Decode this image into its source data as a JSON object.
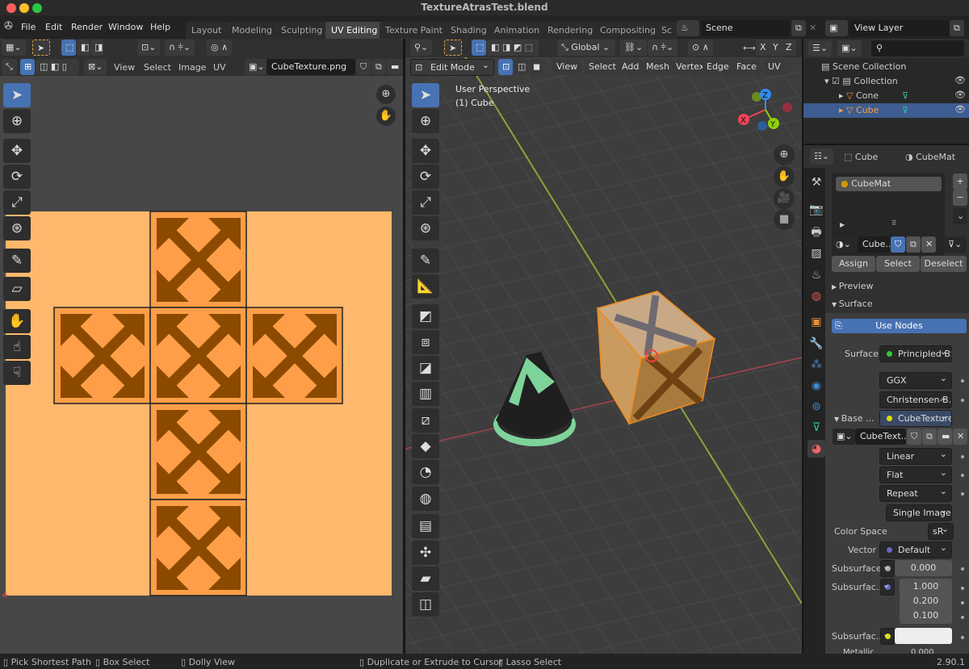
{
  "window": {
    "title": "TextureAtrasTest.blend"
  },
  "menu": [
    "File",
    "Edit",
    "Render",
    "Window",
    "Help"
  ],
  "workspaces": [
    {
      "label": "Layout"
    },
    {
      "label": "Modeling"
    },
    {
      "label": "Sculpting"
    },
    {
      "label": "UV Editing",
      "active": true
    },
    {
      "label": "Texture Paint"
    },
    {
      "label": "Shading"
    },
    {
      "label": "Animation"
    },
    {
      "label": "Rendering"
    },
    {
      "label": "Compositing"
    },
    {
      "label": "Sc"
    }
  ],
  "scene": {
    "name": "Scene",
    "view_layer": "View Layer"
  },
  "uv_editor": {
    "menus": [
      "View",
      "Select",
      "Image",
      "UV"
    ],
    "image_name": "CubeTexture.png",
    "colors": {
      "image_bg": "#ffb86c",
      "face": "#ff9e48",
      "arrow": "#8b4a00"
    }
  },
  "viewport": {
    "mode": "Edit Mode",
    "orientation": "Global",
    "menus": [
      "View",
      "Select",
      "Add",
      "Mesh",
      "Vertex",
      "Edge",
      "Face",
      "UV"
    ],
    "axes": [
      "X",
      "Y",
      "Z"
    ],
    "overlay_line1": "User Perspective",
    "overlay_line2": "(1) Cube",
    "gizmo": {
      "x": "X",
      "y": "Y",
      "z": "Z"
    }
  },
  "outliner": {
    "root": "Scene Collection",
    "collection": "Collection",
    "objects": [
      {
        "name": "Cone",
        "selected": false
      },
      {
        "name": "Cube",
        "selected": true
      }
    ]
  },
  "properties": {
    "object": "Cube",
    "material": "CubeMat",
    "slots": [
      "CubeMat"
    ],
    "material_field": "Cube...",
    "buttons": {
      "assign": "Assign",
      "select": "Select",
      "deselect": "Deselect"
    },
    "panels": {
      "preview": "Preview",
      "surface": "Surface"
    },
    "use_nodes": "Use Nodes",
    "surface_label": "Surface",
    "surface_value": "Principled BS...",
    "distribution": "GGX",
    "subsurface_method": "Christensen-B...",
    "base_label": "Base ...",
    "base_value": "CubeTexture...",
    "image_field": "CubeText...",
    "interpolation": "Linear",
    "projection": "Flat",
    "extension": "Repeat",
    "source": "Single Image",
    "color_space_label": "Color Space",
    "color_space": "sR",
    "vector_label": "Vector",
    "vector_value": "Default",
    "subsurface_label": "Subsurface",
    "subsurface_value": "0.000",
    "subsurface_radius_label": "Subsurfac...",
    "subsurface_radius": [
      "1.000",
      "0.200",
      "0.100"
    ],
    "subsurface_color_label": "Subsurfac...",
    "metallic_label": "Metallic",
    "metallic_value": "0.000"
  },
  "status": {
    "items": [
      "Pick Shortest Path",
      "Box Select",
      "Dolly View",
      "Duplicate or Extrude to Cursor",
      "Lasso Select"
    ],
    "version": "2.90.1"
  }
}
